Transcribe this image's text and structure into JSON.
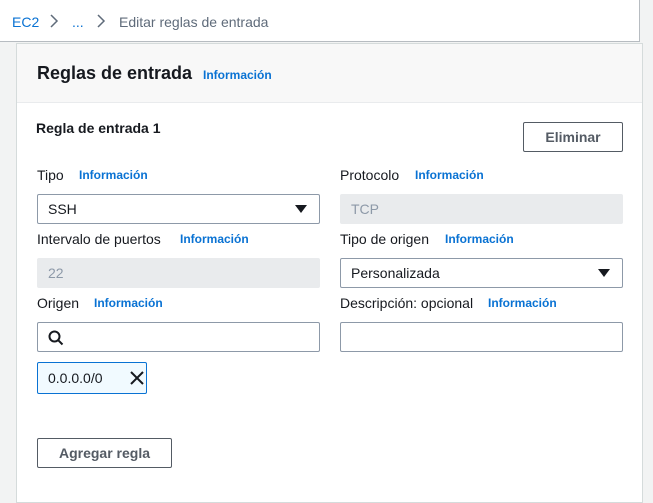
{
  "breadcrumb": {
    "root": "EC2",
    "ellipsis": "...",
    "current": "Editar reglas de entrada"
  },
  "panel": {
    "title": "Reglas de entrada",
    "info": "Información"
  },
  "rule": {
    "title": "Regla de entrada 1",
    "delete_label": "Eliminar",
    "type": {
      "label": "Tipo",
      "info": "Información",
      "value": "SSH"
    },
    "protocol": {
      "label": "Protocolo",
      "info": "Información",
      "value": "TCP"
    },
    "port_range": {
      "label": "Intervalo de puertos",
      "info": "Información",
      "value": "22"
    },
    "source_type": {
      "label": "Tipo de origen",
      "info": "Información",
      "value": "Personalizada"
    },
    "source": {
      "label": "Origen",
      "info": "Información",
      "search_value": "",
      "token": "0.0.0.0/0"
    },
    "description": {
      "label": "Descripción: opcional",
      "info": "Información",
      "value": ""
    }
  },
  "add_rule_label": "Agregar regla",
  "colors": {
    "link": "#0972d3",
    "border": "#8d99a8",
    "disabled_bg": "#e9ebed"
  }
}
